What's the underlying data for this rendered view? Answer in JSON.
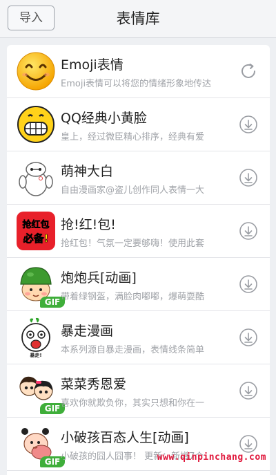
{
  "header": {
    "import_label": "导入",
    "title": "表情库"
  },
  "items": [
    {
      "name": "Emoji表情",
      "desc": "Emoji表情可以将您的情绪形象地传达",
      "action": "refresh-icon",
      "gif": false,
      "icon": "smiley-face-icon"
    },
    {
      "name": "QQ经典小黄脸",
      "desc": "皇上，经过微臣精心排序，经典有爱",
      "action": "download-icon",
      "gif": false,
      "icon": "grin-face-icon"
    },
    {
      "name": "萌神大白",
      "desc": "自由漫画家@盗儿创作同人表情一大",
      "action": "download-icon",
      "gif": false,
      "icon": "baymax-icon"
    },
    {
      "name": "抢!红!包!",
      "desc": "抢红包！气氛一定要够嗨！使用此套",
      "action": "download-icon",
      "gif": false,
      "icon": "red-packet-icon",
      "icon_text": [
        "抢红包",
        "必备!"
      ]
    },
    {
      "name": "炮炮兵[动画]",
      "desc": "带着绿钢盔，满脸肉嘟嘟，爆萌耍酷",
      "action": "download-icon",
      "gif": true,
      "gif_label": "GIF",
      "icon": "soldier-icon"
    },
    {
      "name": "暴走漫画",
      "desc": "本系列源自暴走漫画，表情线条简单",
      "action": "download-icon",
      "gif": false,
      "icon": "rage-comic-icon",
      "icon_text": "暴走!"
    },
    {
      "name": "菜菜秀恩爱",
      "desc": "喜欢你就欺负你，其实只想和你在一",
      "action": "download-icon",
      "gif": true,
      "gif_label": "GIF",
      "icon": "couple-icon"
    },
    {
      "name": "小破孩百态人生[动画]",
      "desc": "小破孩的囧人囧事！ 更新：新增7个",
      "action": "download-icon",
      "gif": true,
      "gif_label": "GIF",
      "icon": "kid-icon"
    }
  ],
  "watermark": "www.qinpinchang.com",
  "colors": {
    "background": "#eef0f3",
    "watermark": "#e0163a",
    "gif_badge": "#3fae3a"
  }
}
